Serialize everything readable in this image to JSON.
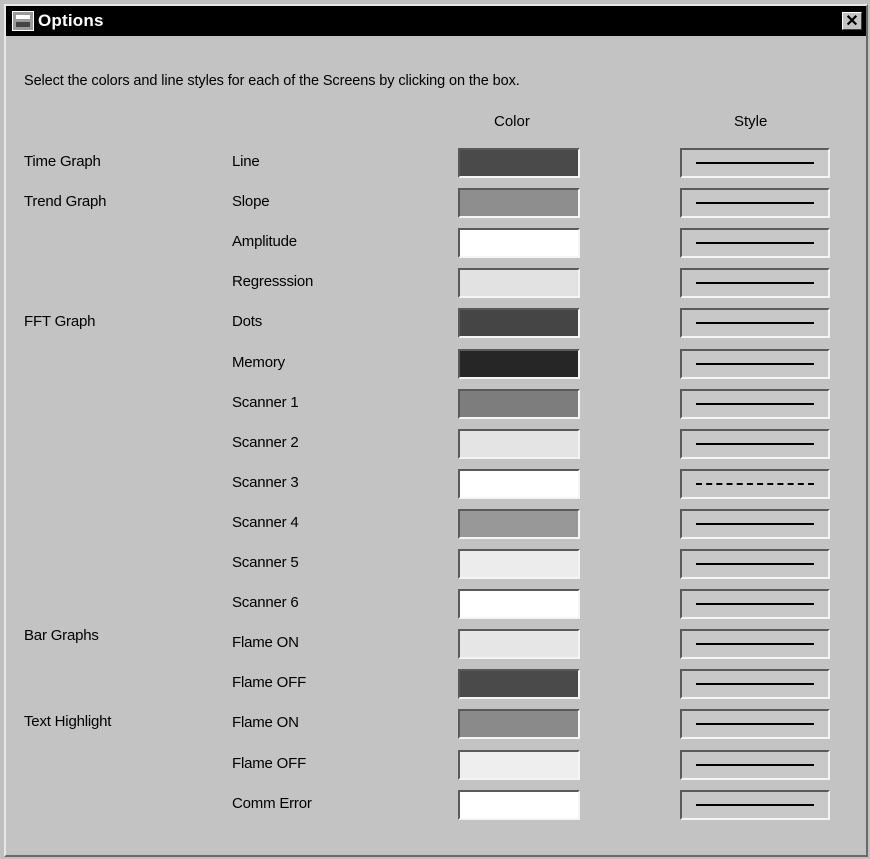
{
  "window": {
    "title": "Options",
    "close_glyph": "✕"
  },
  "instructions": "Select the colors and line styles for each of the Screens by clicking on the box.",
  "columns": {
    "color": "Color",
    "style": "Style"
  },
  "groups": [
    {
      "label": "Time Graph"
    },
    {
      "label": "Trend Graph"
    },
    {
      "label": "FFT Graph"
    },
    {
      "label": "Bar Graphs"
    },
    {
      "label": "Text Highlight"
    }
  ],
  "rows": [
    {
      "label": "Line",
      "color": "#4a4a4a",
      "style": "solid"
    },
    {
      "label": "Slope",
      "color": "#8e8e8e",
      "style": "solid"
    },
    {
      "label": "Amplitude",
      "color": "#ffffff",
      "style": "solid"
    },
    {
      "label": "Regresssion",
      "color": "#e2e2e2",
      "style": "solid"
    },
    {
      "label": "Dots",
      "color": "#454545",
      "style": "solid"
    },
    {
      "label": "Memory",
      "color": "#262626",
      "style": "solid"
    },
    {
      "label": "Scanner 1",
      "color": "#7d7d7d",
      "style": "solid"
    },
    {
      "label": "Scanner 2",
      "color": "#e4e4e4",
      "style": "solid"
    },
    {
      "label": "Scanner 3",
      "color": "#ffffff",
      "style": "dashed"
    },
    {
      "label": "Scanner 4",
      "color": "#989898",
      "style": "solid"
    },
    {
      "label": "Scanner 5",
      "color": "#ececec",
      "style": "solid"
    },
    {
      "label": "Scanner 6",
      "color": "#ffffff",
      "style": "solid"
    },
    {
      "label": "Flame ON",
      "color": "#e6e6e6",
      "style": "solid"
    },
    {
      "label": "Flame OFF",
      "color": "#4a4a4a",
      "style": "solid"
    },
    {
      "label": "Flame ON",
      "color": "#8a8a8a",
      "style": "solid"
    },
    {
      "label": "Flame OFF",
      "color": "#eeeeee",
      "style": "solid"
    },
    {
      "label": "Comm Error",
      "color": "#ffffff",
      "style": "solid"
    }
  ]
}
